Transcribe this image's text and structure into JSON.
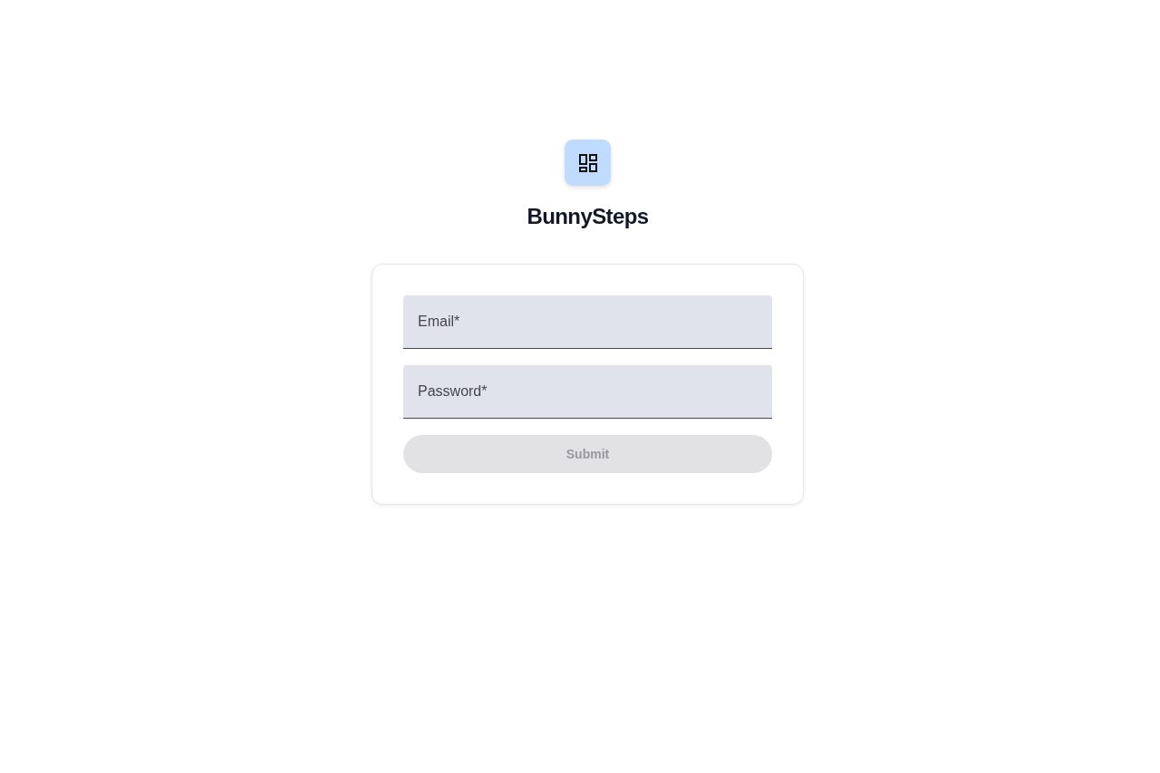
{
  "app": {
    "name": "BunnySteps"
  },
  "form": {
    "fields": [
      {
        "placeholder": "Email*"
      },
      {
        "placeholder": "Password*"
      }
    ],
    "submit": {
      "label": "Submit",
      "disabled": true
    }
  }
}
